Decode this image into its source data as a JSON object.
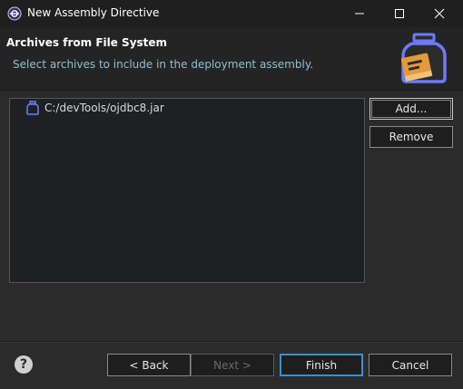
{
  "window": {
    "title": "New Assembly Directive"
  },
  "header": {
    "title": "Archives from File System",
    "description": "Select archives to include in the deployment assembly."
  },
  "archives": {
    "items": [
      {
        "label": "C:/devTools/ojdbc8.jar"
      }
    ]
  },
  "side_buttons": {
    "add_label": "Add...",
    "remove_label": "Remove"
  },
  "footer": {
    "help_label": "?",
    "back_label": "< Back",
    "next_label": "Next >",
    "finish_label": "Finish",
    "cancel_label": "Cancel"
  },
  "colors": {
    "accent": "#3a8fd0",
    "jar_icon": "#6b7bff",
    "book_icon": "#e39a3b"
  }
}
